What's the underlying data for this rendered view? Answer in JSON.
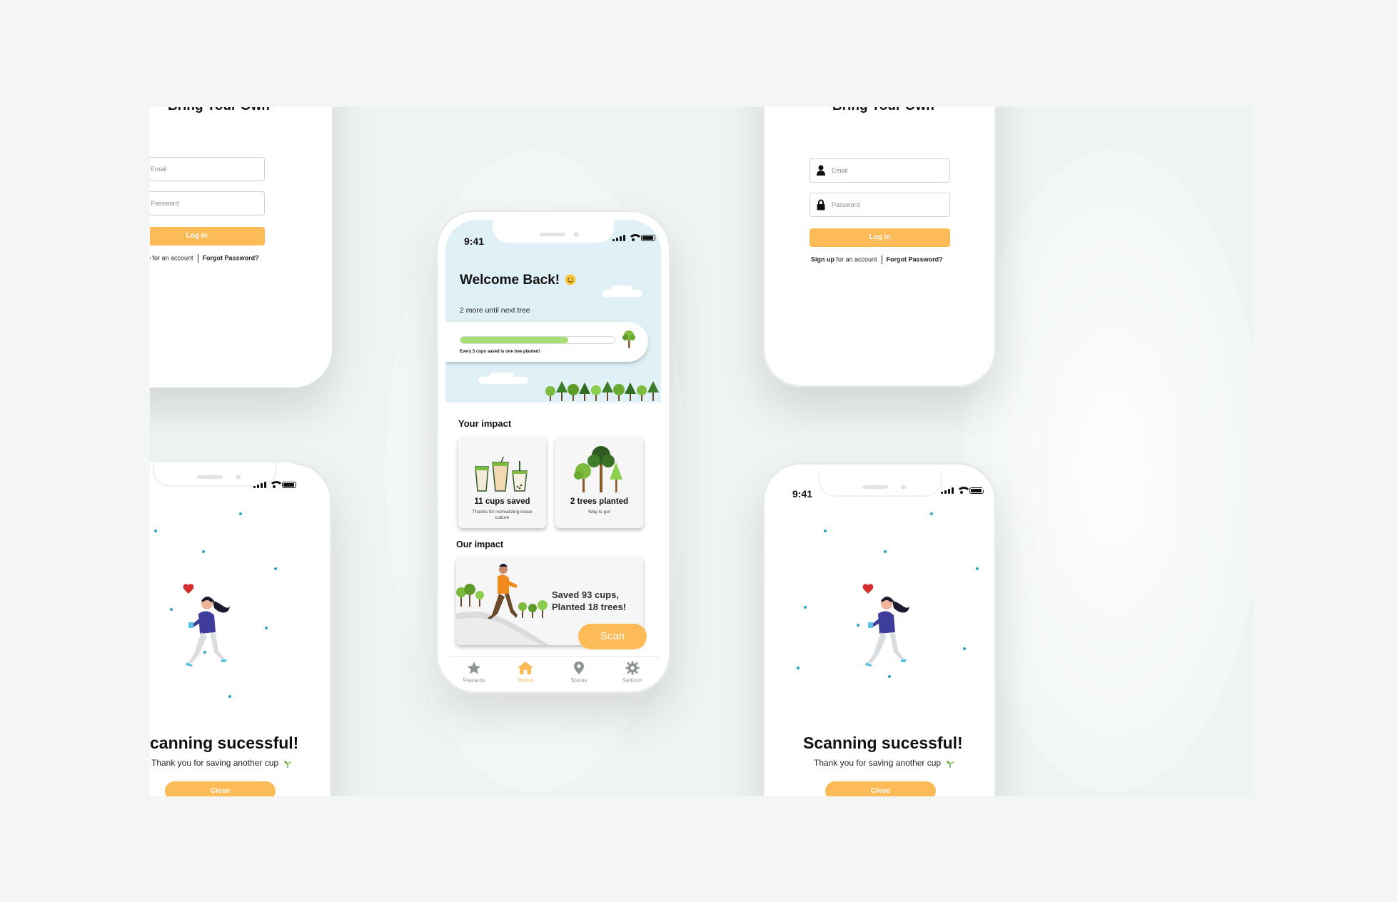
{
  "colors": {
    "accent": "#fdbb57",
    "progress": "#a6dd75",
    "sky": "#dff1f7",
    "dots": "#2aa5c7"
  },
  "login": {
    "title": "Bring Your Own",
    "email_placeholder": "Email",
    "password_placeholder": "Password",
    "login_label": "Log in",
    "signup_label": "Sign up",
    "signup_suffix": "for an account",
    "forgot_label": "Forgot Password?"
  },
  "success": {
    "time": "9:41",
    "title": "Scanning sucessful!",
    "title_cropped": "canning sucessful!",
    "subtitle": "Thank you for saving another cup",
    "close_label": "Close"
  },
  "home": {
    "time": "9:41",
    "welcome": "Welcome Back!",
    "next_tree": "2 more until next tree",
    "progress": 0.7,
    "progress_caption": "Every 5 cups saved is one tree planted!",
    "your_impact": "Your impact",
    "cups_title": "11 cups saved",
    "cups_sub": "Thanks for normalizing reuse culture",
    "trees_title": "2 trees planted",
    "trees_sub": "Way to go!",
    "our_impact": "Our impact",
    "our_line1": "Saved 93 cups,",
    "our_line2": "Planted 18 trees!",
    "scan_label": "Scan",
    "nav": [
      {
        "label": "Rewards",
        "icon": "star-icon"
      },
      {
        "label": "Home",
        "icon": "home-icon"
      },
      {
        "label": "Stores",
        "icon": "location-pin-icon"
      },
      {
        "label": "Settings",
        "icon": "gear-icon"
      }
    ]
  }
}
